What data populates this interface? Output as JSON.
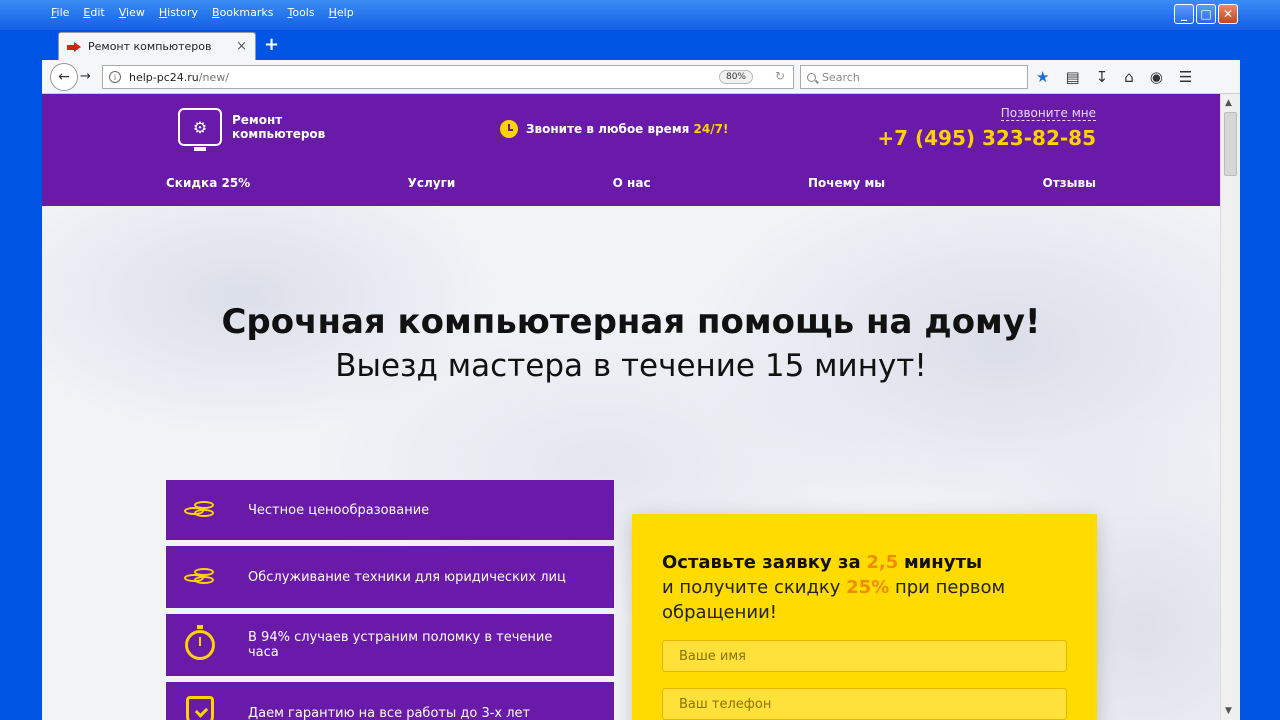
{
  "menubar": {
    "items": [
      "File",
      "Edit",
      "View",
      "History",
      "Bookmarks",
      "Tools",
      "Help"
    ]
  },
  "tab": {
    "title": "Ремонт компьютеров",
    "close": "×",
    "new": "+"
  },
  "navbar": {
    "url_host": "help-pc24.ru",
    "url_path": "/new/",
    "zoom": "80%",
    "search_placeholder": "Search"
  },
  "site": {
    "logo_line1": "Ремонт",
    "logo_line2": "компьютеров",
    "call_text": "Звоните в любое время",
    "call_accent": "24/7!",
    "callme": "Позвоните мне",
    "phone": "+7 (495) 323-82-85",
    "nav": [
      "Скидка 25%",
      "Услуги",
      "О нас",
      "Почему мы",
      "Отзывы"
    ]
  },
  "hero": {
    "title": "Срочная компьютерная помощь на дому!",
    "subtitle": "Выезд мастера в течение 15 минут!"
  },
  "features": [
    {
      "icon": "coins-icon",
      "text": "Честное ценообразование"
    },
    {
      "icon": "coins-icon",
      "text": "Обслуживание техники для юридических лиц"
    },
    {
      "icon": "timer-icon",
      "text": "В 94% случаев устраним поломку в течение часа"
    },
    {
      "icon": "shield-check-icon",
      "text": "Даем гарантию на все работы до 3-х лет"
    }
  ],
  "form": {
    "head_bold": "Оставьте заявку за",
    "head_accent1": "2,5",
    "head_bold2": "минуты",
    "head_line2a": "и получите скидку",
    "head_accent2": "25%",
    "head_line2b": "при первом обращении!",
    "name_placeholder": "Ваше имя",
    "phone_placeholder": "Ваш телефон"
  },
  "colors": {
    "brand_purple": "#6a1aa8",
    "accent_yellow": "#ffd200",
    "accent_orange": "#f08c00"
  }
}
